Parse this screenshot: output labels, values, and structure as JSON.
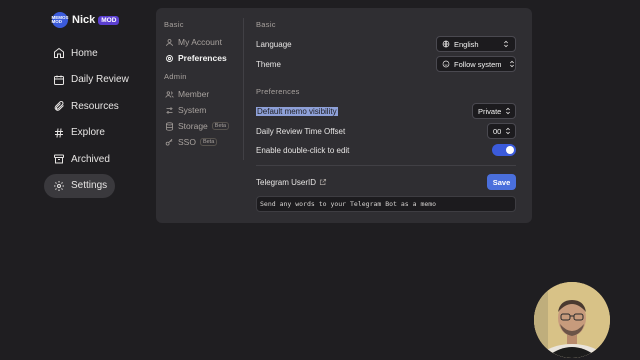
{
  "brand": {
    "logo_text": "MEMOS MOD",
    "name": "Nick",
    "badge": "MOD"
  },
  "nav": {
    "items": [
      {
        "label": "Home",
        "icon": "home-icon"
      },
      {
        "label": "Daily Review",
        "icon": "calendar-icon"
      },
      {
        "label": "Resources",
        "icon": "paperclip-icon"
      },
      {
        "label": "Explore",
        "icon": "hash-icon"
      },
      {
        "label": "Archived",
        "icon": "archive-icon"
      },
      {
        "label": "Settings",
        "icon": "gear-icon",
        "active": true
      }
    ]
  },
  "settings_nav": {
    "basic_heading": "Basic",
    "basic_items": [
      {
        "label": "My Account",
        "icon": "user-icon"
      },
      {
        "label": "Preferences",
        "icon": "gear-icon",
        "active": true
      }
    ],
    "admin_heading": "Admin",
    "admin_items": [
      {
        "label": "Member",
        "icon": "users-icon"
      },
      {
        "label": "System",
        "icon": "sliders-icon"
      },
      {
        "label": "Storage",
        "icon": "database-icon",
        "badge": "Beta"
      },
      {
        "label": "SSO",
        "icon": "key-icon",
        "badge": "Beta"
      }
    ]
  },
  "basic": {
    "heading": "Basic",
    "language_label": "Language",
    "language_value": "English",
    "theme_label": "Theme",
    "theme_value": "Follow system"
  },
  "preferences": {
    "heading": "Preferences",
    "visibility_label": "Default memo visibility",
    "visibility_value": "Private",
    "review_offset_label": "Daily Review Time Offset",
    "review_offset_value": "00",
    "double_click_label": "Enable double-click to edit",
    "double_click_enabled": true
  },
  "telegram": {
    "label": "Telegram UserID",
    "save_label": "Save",
    "placeholder": "Send any words to your Telegram Bot as a memo"
  },
  "colors": {
    "accent": "#3b5bdb",
    "panel": "#2f2e32",
    "background": "#1f1e21",
    "badge": "#5b3fd1"
  }
}
